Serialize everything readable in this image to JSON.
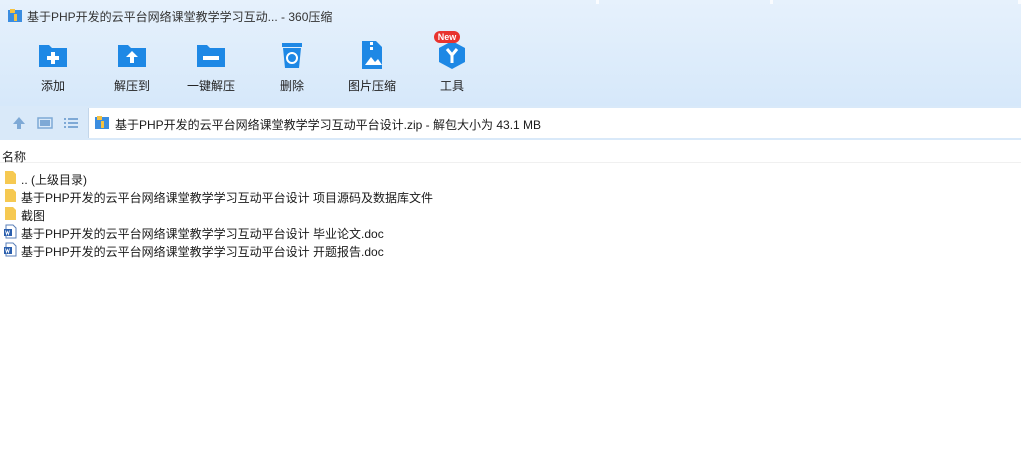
{
  "window": {
    "title": "基于PHP开发的云平台网络课堂教学学习互动... - 360压缩"
  },
  "toolbar": {
    "items": [
      {
        "label": "添加",
        "icon": "add-icon"
      },
      {
        "label": "解压到",
        "icon": "extract-to-icon"
      },
      {
        "label": "一键解压",
        "icon": "one-click-extract-icon"
      },
      {
        "label": "删除",
        "icon": "delete-icon"
      },
      {
        "label": "图片压缩",
        "icon": "image-compress-icon"
      },
      {
        "label": "工具",
        "icon": "tools-icon",
        "badge": "New"
      }
    ]
  },
  "nav": {
    "buttons": [
      "up-icon",
      "view-icon",
      "list-view-icon"
    ],
    "address_text": "基于PHP开发的云平台网络课堂教学学习互动平台设计.zip - 解包大小为 43.1 MB"
  },
  "file_list": {
    "column_name": "名称",
    "rows": [
      {
        "name": ".. (上级目录)",
        "type": "folder"
      },
      {
        "name": "基于PHP开发的云平台网络课堂教学学习互动平台设计 项目源码及数据库文件",
        "type": "folder"
      },
      {
        "name": "截图",
        "type": "folder"
      },
      {
        "name": "基于PHP开发的云平台网络课堂教学学习互动平台设计 毕业论文.doc",
        "type": "doc"
      },
      {
        "name": "基于PHP开发的云平台网络课堂教学学习互动平台设计 开题报告.doc",
        "type": "doc"
      }
    ]
  },
  "colors": {
    "header_bg": "#d6e8fa",
    "accent_blue": "#1e88e5",
    "folder_yellow": "#f6c951",
    "badge_red": "#e8332e"
  }
}
